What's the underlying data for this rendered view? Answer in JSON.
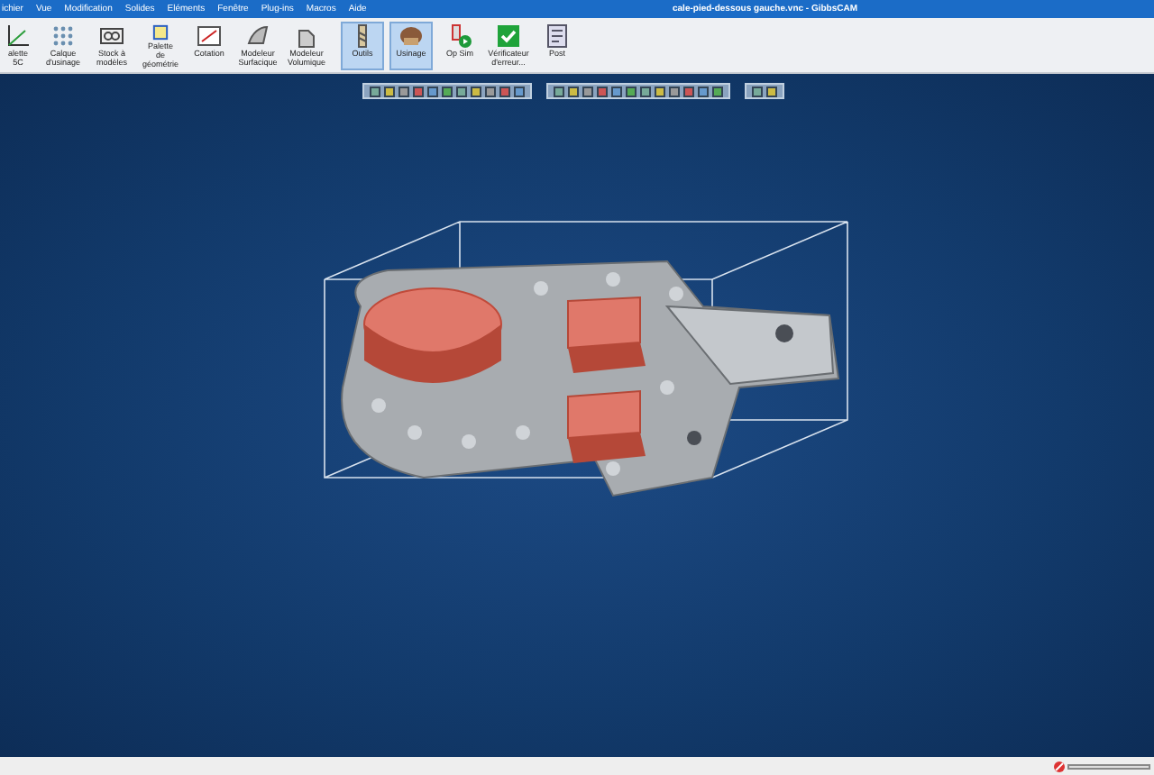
{
  "title_bar": {
    "menus": [
      "ichier",
      "Vue",
      "Modification",
      "Solides",
      "Eléments",
      "Fenêtre",
      "Plug-ins",
      "Macros",
      "Aide"
    ],
    "title": "cale-pied-dessous gauche.vnc - GibbsCAM"
  },
  "ribbon": {
    "tools": [
      {
        "label": "alette 5C",
        "kind": "axes",
        "selected": false
      },
      {
        "label": "Calque d'usinage",
        "kind": "layers",
        "selected": false
      },
      {
        "label": "Stock à modèles",
        "kind": "stock",
        "selected": false
      },
      {
        "label": "Palette de géométrie",
        "kind": "geometry",
        "selected": false
      },
      {
        "label": "Cotation",
        "kind": "dimension",
        "selected": false
      },
      {
        "label": "Modeleur Surfacique",
        "kind": "surface",
        "selected": false
      },
      {
        "label": "Modeleur Volumique",
        "kind": "solid",
        "selected": false
      },
      {
        "label": "Outils",
        "kind": "tool",
        "selected": true
      },
      {
        "label": "Usinage",
        "kind": "machining",
        "selected": true
      },
      {
        "label": "Op Sim",
        "kind": "sim",
        "selected": false
      },
      {
        "label": "Vérificateur d'erreur...",
        "kind": "check",
        "selected": false
      },
      {
        "label": "Post",
        "kind": "post",
        "selected": false
      }
    ]
  }
}
